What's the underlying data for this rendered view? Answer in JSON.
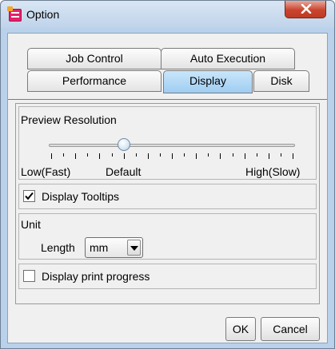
{
  "window": {
    "title": "Option",
    "close_glyph": "X"
  },
  "tabs": {
    "row1": [
      {
        "label": "Job Control"
      },
      {
        "label": "Auto Execution"
      }
    ],
    "row2": [
      {
        "label": "Performance"
      },
      {
        "label": "Display",
        "selected": true
      },
      {
        "label": "Disk"
      }
    ]
  },
  "preview_resolution": {
    "title": "Preview Resolution",
    "label_low": "Low(Fast)",
    "label_default": "Default",
    "label_high": "High(Slow)",
    "slider_position": 0.3
  },
  "display_tooltips": {
    "label": "Display Tooltips",
    "checked": true
  },
  "unit": {
    "title": "Unit",
    "length_label": "Length",
    "length_value": "mm"
  },
  "display_print_progress": {
    "label": "Display print progress",
    "checked": false
  },
  "buttons": {
    "ok": "OK",
    "cancel": "Cancel"
  },
  "colors": {
    "selected_tab": "#a8d3f4",
    "close_button": "#c9452f"
  }
}
